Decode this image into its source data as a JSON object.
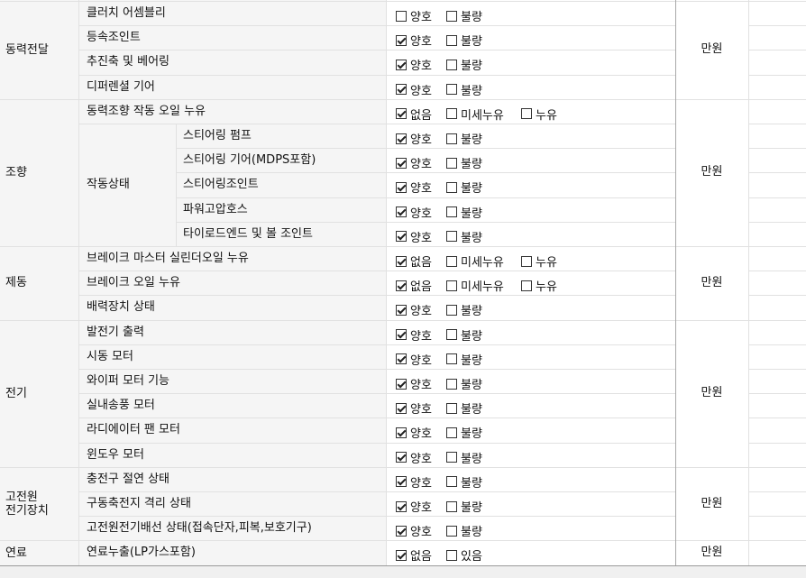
{
  "rows": [
    {
      "cat_ref": 0,
      "item": "클러치 어셈블리",
      "options": [
        {
          "label": "양호",
          "checked": false
        },
        {
          "label": "불량",
          "checked": false
        }
      ]
    },
    {
      "cat_ref": 0,
      "item": "등속조인트",
      "options": [
        {
          "label": "양호",
          "checked": true
        },
        {
          "label": "불량",
          "checked": false
        }
      ]
    },
    {
      "cat_ref": 0,
      "item": "추진축 및 베어링",
      "options": [
        {
          "label": "양호",
          "checked": true
        },
        {
          "label": "불량",
          "checked": false
        }
      ]
    },
    {
      "cat_ref": 0,
      "item": "디퍼렌셜 기어",
      "options": [
        {
          "label": "양호",
          "checked": true
        },
        {
          "label": "불량",
          "checked": false
        }
      ]
    },
    {
      "cat_ref": 1,
      "item": "동력조향 작동 오일 누유",
      "options": [
        {
          "label": "없음",
          "checked": true
        },
        {
          "label": "미세누유",
          "checked": false
        },
        {
          "label": "누유",
          "checked": false
        }
      ]
    },
    {
      "cat_ref": 1,
      "group": "작동상태",
      "item": "스티어링 펌프",
      "options": [
        {
          "label": "양호",
          "checked": true
        },
        {
          "label": "불량",
          "checked": false
        }
      ]
    },
    {
      "cat_ref": 1,
      "group": "작동상태",
      "item": "스티어링 기어(MDPS포함)",
      "options": [
        {
          "label": "양호",
          "checked": true
        },
        {
          "label": "불량",
          "checked": false
        }
      ]
    },
    {
      "cat_ref": 1,
      "group": "작동상태",
      "item": "스티어링조인트",
      "options": [
        {
          "label": "양호",
          "checked": true
        },
        {
          "label": "불량",
          "checked": false
        }
      ]
    },
    {
      "cat_ref": 1,
      "group": "작동상태",
      "item": "파워고압호스",
      "options": [
        {
          "label": "양호",
          "checked": true
        },
        {
          "label": "불량",
          "checked": false
        }
      ]
    },
    {
      "cat_ref": 1,
      "group": "작동상태",
      "item": "타이로드엔드 및 볼 조인트",
      "options": [
        {
          "label": "양호",
          "checked": true
        },
        {
          "label": "불량",
          "checked": false
        }
      ]
    },
    {
      "cat_ref": 2,
      "item": "브레이크 마스터 실린더오일 누유",
      "options": [
        {
          "label": "없음",
          "checked": true
        },
        {
          "label": "미세누유",
          "checked": false
        },
        {
          "label": "누유",
          "checked": false
        }
      ]
    },
    {
      "cat_ref": 2,
      "item": "브레이크 오일 누유",
      "options": [
        {
          "label": "없음",
          "checked": true
        },
        {
          "label": "미세누유",
          "checked": false
        },
        {
          "label": "누유",
          "checked": false
        }
      ]
    },
    {
      "cat_ref": 2,
      "item": "배력장치 상태",
      "options": [
        {
          "label": "양호",
          "checked": true
        },
        {
          "label": "불량",
          "checked": false
        }
      ]
    },
    {
      "cat_ref": 3,
      "item": "발전기 출력",
      "options": [
        {
          "label": "양호",
          "checked": true
        },
        {
          "label": "불량",
          "checked": false
        }
      ]
    },
    {
      "cat_ref": 3,
      "item": "시동 모터",
      "options": [
        {
          "label": "양호",
          "checked": true
        },
        {
          "label": "불량",
          "checked": false
        }
      ]
    },
    {
      "cat_ref": 3,
      "item": "와이퍼 모터 기능",
      "options": [
        {
          "label": "양호",
          "checked": true
        },
        {
          "label": "불량",
          "checked": false
        }
      ]
    },
    {
      "cat_ref": 3,
      "item": "실내송풍 모터",
      "options": [
        {
          "label": "양호",
          "checked": true
        },
        {
          "label": "불량",
          "checked": false
        }
      ]
    },
    {
      "cat_ref": 3,
      "item": "라디에이터 팬 모터",
      "options": [
        {
          "label": "양호",
          "checked": true
        },
        {
          "label": "불량",
          "checked": false
        }
      ]
    },
    {
      "cat_ref": 3,
      "item": "윈도우 모터",
      "options": [
        {
          "label": "양호",
          "checked": true
        },
        {
          "label": "불량",
          "checked": false
        }
      ]
    },
    {
      "cat_ref": 4,
      "item": "충전구 절연 상태",
      "options": [
        {
          "label": "양호",
          "checked": true
        },
        {
          "label": "불량",
          "checked": false
        }
      ]
    },
    {
      "cat_ref": 4,
      "item": "구동축전지 격리 상태",
      "options": [
        {
          "label": "양호",
          "checked": true
        },
        {
          "label": "불량",
          "checked": false
        }
      ]
    },
    {
      "cat_ref": 4,
      "item": "고전원전기배선 상태(접속단자,피복,보호기구)",
      "options": [
        {
          "label": "양호",
          "checked": true
        },
        {
          "label": "불량",
          "checked": false
        }
      ]
    },
    {
      "cat_ref": 5,
      "item": "연료누출(LP가스포함)",
      "options": [
        {
          "label": "없음",
          "checked": true
        },
        {
          "label": "있음",
          "checked": false
        }
      ]
    }
  ],
  "categories": [
    {
      "label": "동력전달",
      "unit": "만원"
    },
    {
      "label": "조향",
      "unit": "만원"
    },
    {
      "label": "제동",
      "unit": "만원"
    },
    {
      "label": "전기",
      "unit": "만원"
    },
    {
      "label": "고전원\n전기장치",
      "unit": "만원"
    },
    {
      "label": "연료",
      "unit": "만원"
    }
  ]
}
